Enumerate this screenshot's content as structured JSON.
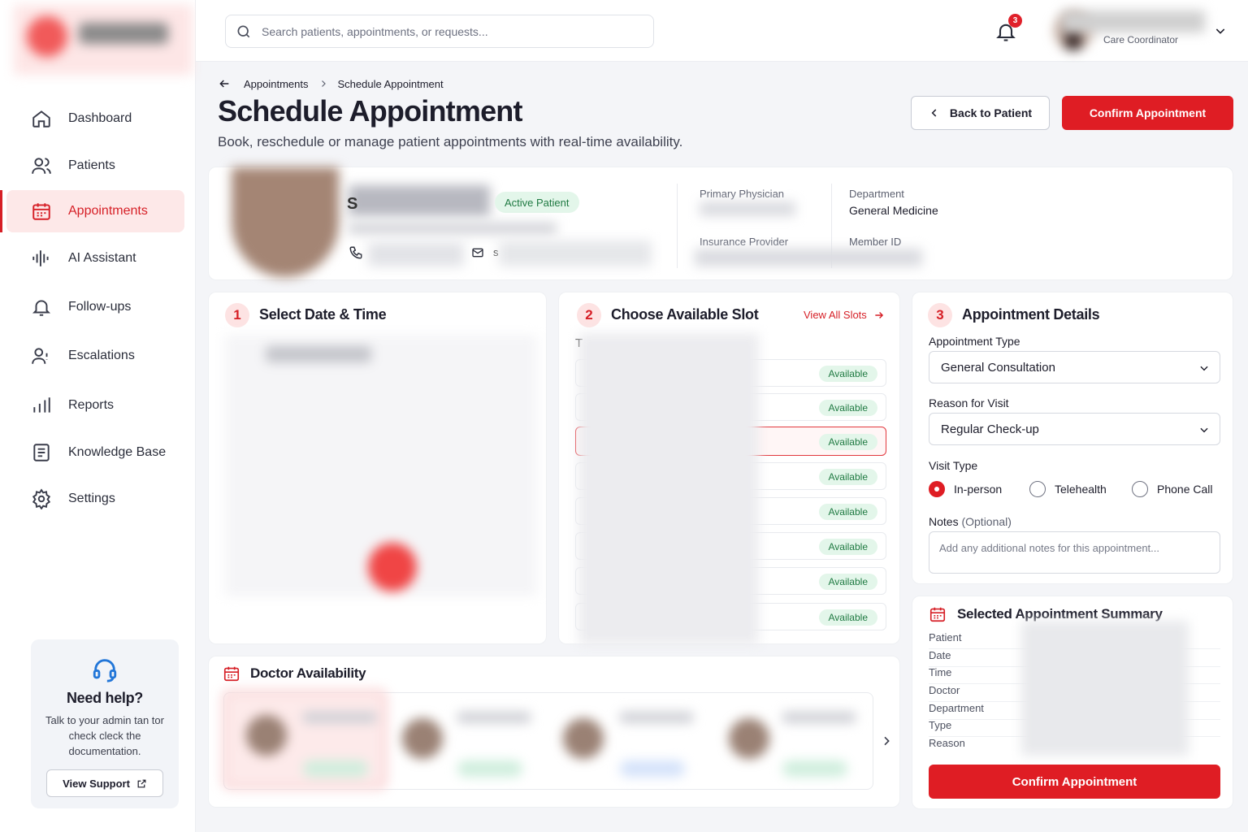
{
  "sidebar": {
    "items": [
      {
        "label": "Dashboard",
        "icon": "home-icon"
      },
      {
        "label": "Patients",
        "icon": "users-icon"
      },
      {
        "label": "Appointments",
        "icon": "calendar-icon",
        "active": true
      },
      {
        "label": "AI Assistant",
        "icon": "waveform-icon"
      },
      {
        "label": "Follow-ups",
        "icon": "bell-icon"
      },
      {
        "label": "Escalations",
        "icon": "user-alert-icon"
      },
      {
        "label": "Reports",
        "icon": "bar-chart-icon"
      },
      {
        "label": "Knowledge Base",
        "icon": "book-icon"
      },
      {
        "label": "Settings",
        "icon": "gear-icon"
      }
    ],
    "help": {
      "title": "Need help?",
      "text": "Talk to your admin tan tor check cleck the documentation.",
      "button": "View Support"
    }
  },
  "topbar": {
    "search_placeholder": "Search patients, appointments, or requests...",
    "notification_count": "3",
    "user_role": "Care Coordinator"
  },
  "page": {
    "breadcrumb": [
      "Appointments",
      "Schedule Appointment"
    ],
    "title": "Schedule Appointment",
    "subtitle": "Book, reschedule or manage patient appointments with real-time availability.",
    "back_button": "Back to Patient",
    "confirm_button": "Confirm Appointment"
  },
  "patient": {
    "name_initial": "S",
    "status": "Active Patient",
    "email_initial": "s",
    "primary_physician_label": "Primary Physician",
    "department_label": "Department",
    "department_value": "General Medicine",
    "insurance_label": "Insurance Provider",
    "member_id_label": "Member ID"
  },
  "step1": {
    "number": "1",
    "title": "Select Date & Time"
  },
  "step2": {
    "number": "2",
    "title": "Choose Available Slot",
    "view_all": "View All Slots",
    "time_prefix": "T",
    "slots": [
      {
        "status": "Available"
      },
      {
        "status": "Available"
      },
      {
        "status": "Available",
        "selected": true
      },
      {
        "status": "Available"
      },
      {
        "status": "Available"
      },
      {
        "status": "Available"
      },
      {
        "status": "Available"
      },
      {
        "status": "Available"
      }
    ]
  },
  "step3": {
    "number": "3",
    "title": "Appointment Details",
    "appointment_type_label": "Appointment Type",
    "appointment_type_value": "General Consultation",
    "reason_label": "Reason for Visit",
    "reason_value": "Regular Check-up",
    "visit_type_label": "Visit Type",
    "visit_types": [
      "In-person",
      "Telehealth",
      "Phone Call"
    ],
    "visit_type_selected": "In-person",
    "notes_label": "Notes",
    "notes_optional": "(Optional)",
    "notes_placeholder": "Add any additional notes for this appointment..."
  },
  "summary": {
    "title": "Selected Appointment Summary",
    "rows": [
      "Patient",
      "Date",
      "Time",
      "Doctor",
      "Department",
      "Type",
      "Reason"
    ],
    "button": "Confirm Appointment"
  },
  "doctor_availability": {
    "title": "Doctor Availability"
  },
  "colors": {
    "accent": "#df1d24",
    "available_bg": "#e3f6ea",
    "available_text": "#1f7a42"
  }
}
